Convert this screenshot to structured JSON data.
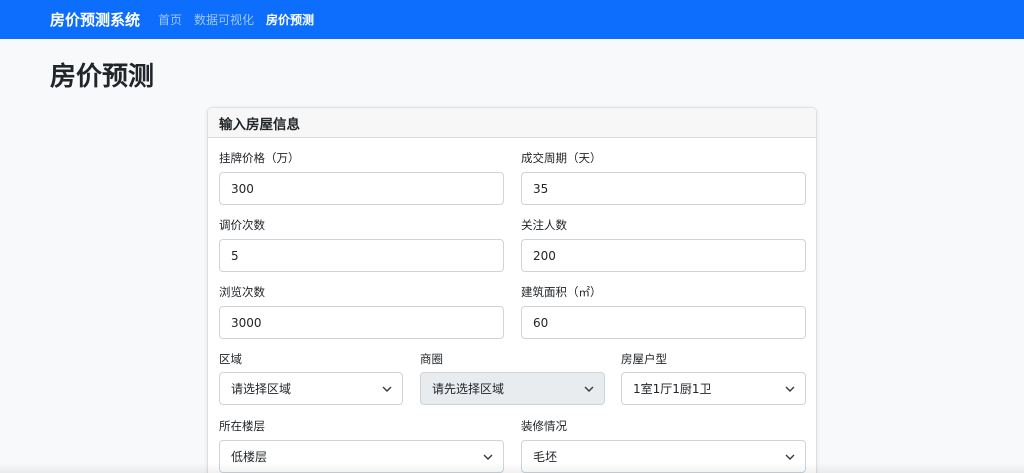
{
  "navbar": {
    "brand": "房价预测系统",
    "links": [
      {
        "label": "首页",
        "active": false
      },
      {
        "label": "数据可视化",
        "active": false
      },
      {
        "label": "房价预测",
        "active": true
      }
    ],
    "color": "#0d6efd"
  },
  "page": {
    "title": "房价预测"
  },
  "form": {
    "header": "输入房屋信息",
    "fields": {
      "listing_price": {
        "label": "挂牌价格（万）",
        "value": "300"
      },
      "deal_cycle": {
        "label": "成交周期（天）",
        "value": "35"
      },
      "price_adjustments": {
        "label": "调价次数",
        "value": "5"
      },
      "followers": {
        "label": "关注人数",
        "value": "200"
      },
      "views": {
        "label": "浏览次数",
        "value": "3000"
      },
      "area": {
        "label": "建筑面积（㎡）",
        "value": "60"
      },
      "district": {
        "label": "区域",
        "value": "请选择区域"
      },
      "business_circle": {
        "label": "商圈",
        "value": "请先选择区域",
        "disabled": true
      },
      "layout": {
        "label": "房屋户型",
        "value": "1室1厅1厨1卫"
      },
      "floor": {
        "label": "所在楼层",
        "value": "低楼层"
      },
      "decoration": {
        "label": "装修情况",
        "value": "毛坯"
      }
    }
  }
}
